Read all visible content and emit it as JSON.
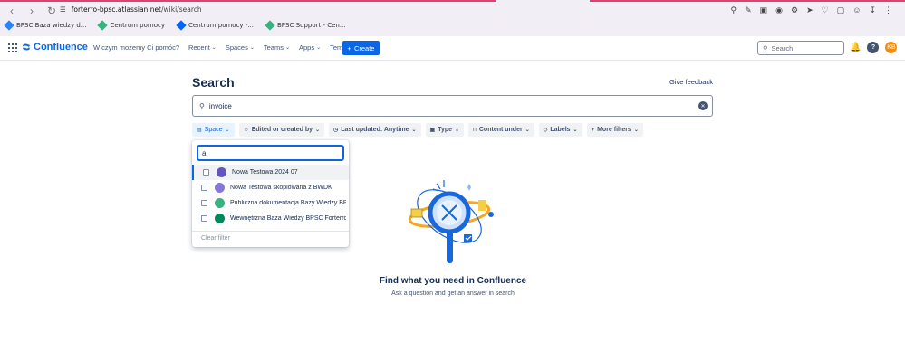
{
  "browser": {
    "url_host": "forterro-bpsc.atlassian.net",
    "url_path": "/wiki/search",
    "bookmarks": [
      {
        "label": "BPSC Baza wiedzy d...",
        "color": "#2684ff"
      },
      {
        "label": "Centrum pomocy",
        "color": "#36b37e"
      },
      {
        "label": "Centrum pomocy -...",
        "color": "#0065ff"
      },
      {
        "label": "BPSC Support - Cen...",
        "color": "#36b37e"
      }
    ]
  },
  "header": {
    "logo_text": "Confluence",
    "menu": [
      {
        "label": "W czym możemy Ci pomóc?",
        "caret": false
      },
      {
        "label": "Recent",
        "caret": true
      },
      {
        "label": "Spaces",
        "caret": true
      },
      {
        "label": "Teams",
        "caret": true
      },
      {
        "label": "Apps",
        "caret": true
      },
      {
        "label": "Templates",
        "caret": false
      }
    ],
    "create_label": "Create",
    "search_placeholder": "Search",
    "avatar_initials": "KB"
  },
  "page": {
    "title": "Search",
    "feedback_label": "Give feedback",
    "query": "invoice"
  },
  "filters": [
    {
      "label": "Space",
      "active": true
    },
    {
      "label": "Edited or created by",
      "active": false
    },
    {
      "label": "Last updated: Anytime",
      "active": false
    },
    {
      "label": "Type",
      "active": false
    },
    {
      "label": "Content under",
      "active": false
    },
    {
      "label": "Labels",
      "active": false
    },
    {
      "label": "More filters",
      "active": false
    }
  ],
  "space_dropdown": {
    "query": "a",
    "items": [
      {
        "label": "Nowa Testowa 2024 07",
        "color": "#6554c0",
        "highlighted": true
      },
      {
        "label": "Nowa Testowa skopiowana z BWDK",
        "color": "#8777d9",
        "highlighted": false
      },
      {
        "label": "Publiczna dokumentacja Bazy Wiedzy BPSC",
        "color": "#36b37e",
        "highlighted": false
      },
      {
        "label": "Wewnętrzna Baza Wiedzy BPSC Forterro",
        "color": "#00875a",
        "highlighted": false
      }
    ],
    "clear_label": "Clear filter"
  },
  "empty_state": {
    "title": "Find what you need in Confluence",
    "subtitle": "Ask a question and get an answer in search"
  }
}
